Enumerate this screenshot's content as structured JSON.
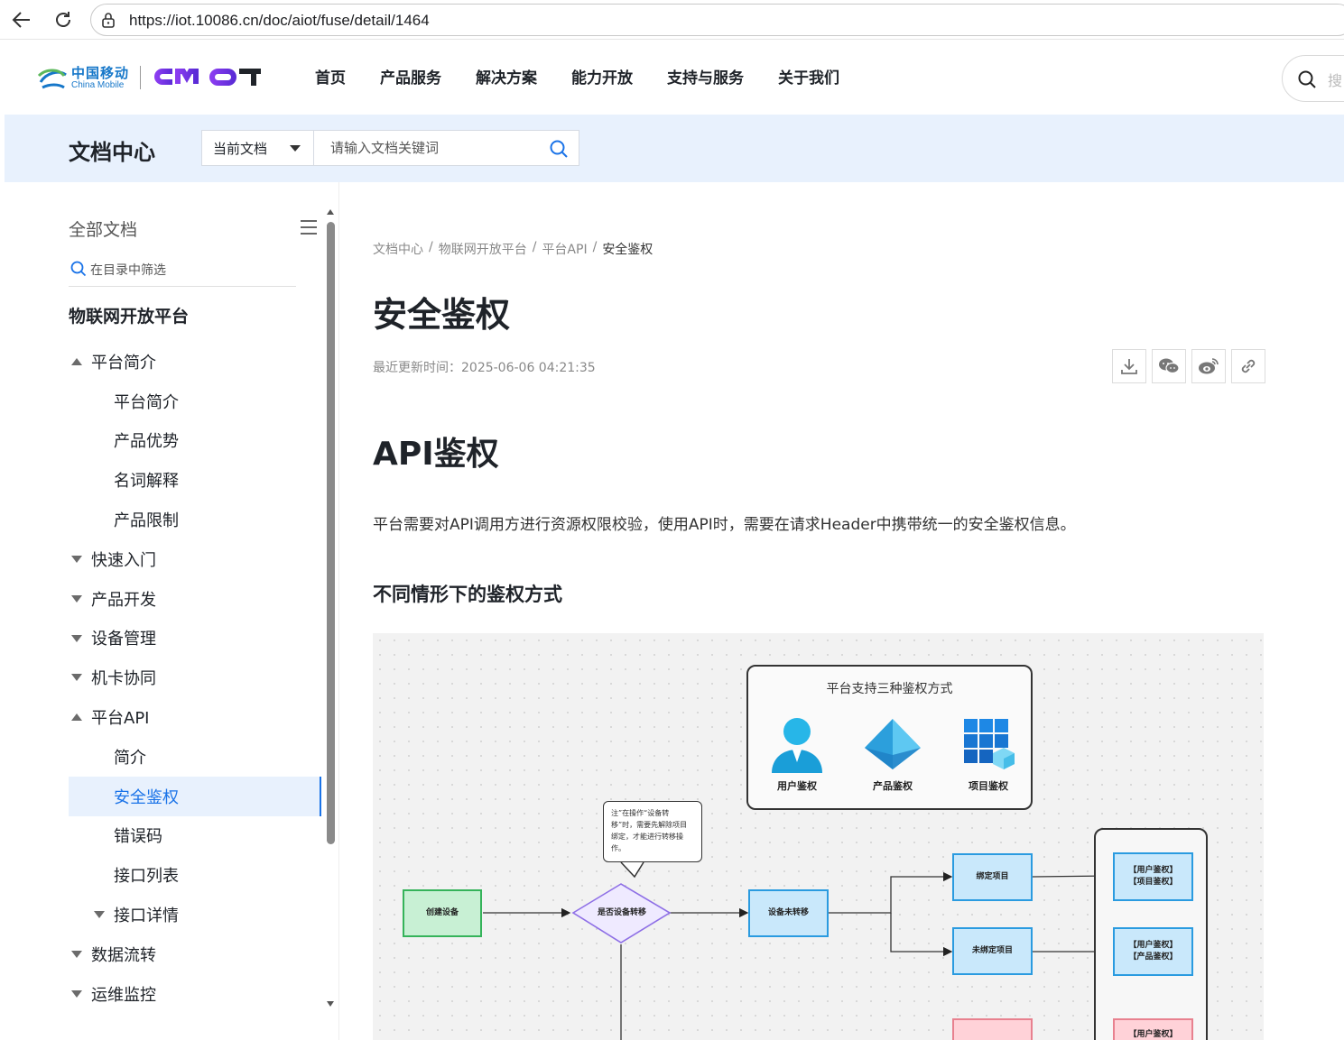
{
  "browser": {
    "url": "https://iot.10086.cn/doc/aiot/fuse/detail/1464"
  },
  "header": {
    "logo_cn": "中国移动",
    "logo_en": "China Mobile",
    "nav": [
      "首页",
      "产品服务",
      "解决方案",
      "能力开放",
      "支持与服务",
      "关于我们"
    ],
    "search_placeholder": "搜"
  },
  "banner": {
    "title": "文档中心",
    "scope": "当前文档",
    "search_placeholder": "请输入文档关键词"
  },
  "sidebar": {
    "all_docs": "全部文档",
    "filter_placeholder": "在目录中筛选",
    "platform": "物联网开放平台",
    "items": [
      {
        "label": "平台简介",
        "level": 1,
        "arrow": "up"
      },
      {
        "label": "平台简介",
        "level": 2
      },
      {
        "label": "产品优势",
        "level": 2
      },
      {
        "label": "名词解释",
        "level": 2
      },
      {
        "label": "产品限制",
        "level": 2
      },
      {
        "label": "快速入门",
        "level": 1,
        "arrow": "down"
      },
      {
        "label": "产品开发",
        "level": 1,
        "arrow": "down"
      },
      {
        "label": "设备管理",
        "level": 1,
        "arrow": "down"
      },
      {
        "label": "机卡协同",
        "level": 1,
        "arrow": "down"
      },
      {
        "label": "平台API",
        "level": 1,
        "arrow": "up"
      },
      {
        "label": "简介",
        "level": 2
      },
      {
        "label": "安全鉴权",
        "level": 2,
        "active": true
      },
      {
        "label": "错误码",
        "level": 2
      },
      {
        "label": "接口列表",
        "level": 2
      },
      {
        "label": "接口详情",
        "level": 2,
        "arrow": "down"
      },
      {
        "label": "数据流转",
        "level": 1,
        "arrow": "down"
      },
      {
        "label": "运维监控",
        "level": 1,
        "arrow": "down"
      }
    ]
  },
  "content": {
    "breadcrumb": [
      "文档中心",
      "物联网开放平台",
      "平台API",
      "安全鉴权"
    ],
    "breadcrumb_sep": "/",
    "title": "安全鉴权",
    "updated": "最近更新时间：2025-06-06 04:21:35",
    "h1": "API鉴权",
    "para": "平台需要对API调用方进行资源权限校验，使用API时，需要在请求Header中携带统一的安全鉴权信息。",
    "h2": "不同情形下的鉴权方式"
  },
  "diagram": {
    "panel_title": "平台支持三种鉴权方式",
    "auth_user": "用户鉴权",
    "auth_product": "产品鉴权",
    "auth_project": "项目鉴权",
    "note": "注”在操作“设备转移”时，需要先解除项目绑定，才能进行转移操作。",
    "create_device": "创建设备",
    "is_transfer": "是否设备转移",
    "not_transfer": "设备未转移",
    "bind_project": "绑定项目",
    "unbind_project": "未绑定项目",
    "result1_a": "【用户鉴权】",
    "result1_b": "【项目鉴权】",
    "result2_a": "【用户鉴权】",
    "result2_b": "【产品鉴权】",
    "result3_a": "【用户鉴权】"
  },
  "colors": {
    "accent": "#1a73e8",
    "banner_bg": "#e8f1fd",
    "green_box": "#c8f0d4",
    "blue_box": "#c9e8fb",
    "purple_diamond": "#efeaff"
  }
}
